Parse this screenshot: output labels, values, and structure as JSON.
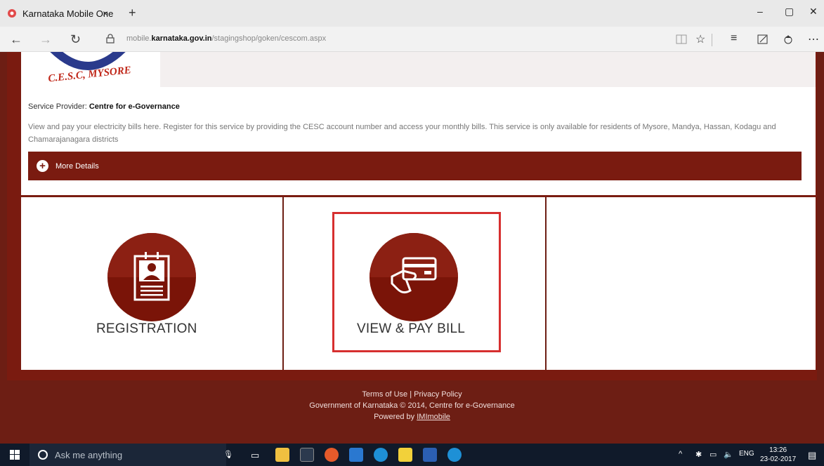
{
  "browser": {
    "tab_title": "Karnataka Mobile One",
    "tab_close": "×",
    "new_tab": "+",
    "url_prefix": "mobile.",
    "url_domain": "karnataka.gov.in",
    "url_path": "/stagingshop/goken/cescom.aspx",
    "minimize": "–",
    "maximize": "▢",
    "close": "✕",
    "back": "←",
    "forward": "→",
    "refresh": "↻"
  },
  "colors": {
    "brand_maroon": "#7a1b10",
    "highlight_red": "#d62f2f"
  },
  "page": {
    "logo_text": "C.E.S.C, MYSORE",
    "provider_label": "Service Provider:",
    "provider_name": "Centre for e-Governance",
    "description": "View and pay your electricity bills here. Register for this service by providing the CESC account number and access your monthly bills. This service is only available for residents of Mysore, Mandya, Hassan, Kodagu and Chamarajanagara districts",
    "more_details": "More Details",
    "cards": {
      "registration": "REGISTRATION",
      "view_pay_bill": "VIEW & PAY BILL"
    }
  },
  "footer": {
    "terms": "Terms of Use",
    "separator": " | ",
    "privacy": "Privacy Policy",
    "copyright": "Government of Karnataka © 2014, Centre for e-Governance",
    "powered_by": "Powered by ",
    "powered_link": "IMImobile"
  },
  "taskbar": {
    "search_placeholder": "Ask me anything",
    "language": "ENG",
    "time": "13:26",
    "date": "23-02-2017"
  }
}
